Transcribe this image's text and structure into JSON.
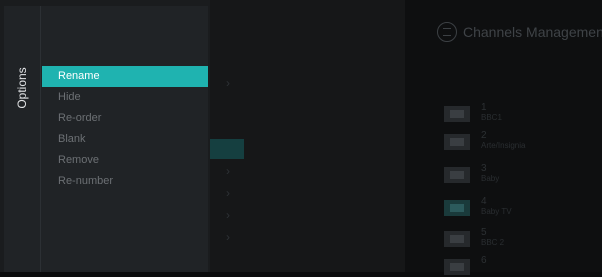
{
  "options_panel": {
    "label": "Options",
    "items": [
      {
        "label": "Rename",
        "selected": true
      },
      {
        "label": "Hide",
        "selected": false
      },
      {
        "label": "Re-order",
        "selected": false
      },
      {
        "label": "Blank",
        "selected": false
      },
      {
        "label": "Remove",
        "selected": false
      },
      {
        "label": "Re-number",
        "selected": false
      }
    ]
  },
  "background_screen": {
    "title": "Channels Management",
    "title_icon": "list-circle-icon",
    "channels": [
      {
        "number": "1",
        "name": "BBC1"
      },
      {
        "number": "2",
        "name": "Arte/Insignia"
      },
      {
        "number": "3",
        "name": "Baby"
      },
      {
        "number": "4",
        "name": "Baby TV",
        "active": true
      },
      {
        "number": "5",
        "name": "BBC 2"
      },
      {
        "number": "6",
        "name": ""
      }
    ]
  },
  "colors": {
    "accent": "#1fb3b0",
    "panel_bg": "#202326",
    "screen_bg": "#0b0c0d"
  }
}
